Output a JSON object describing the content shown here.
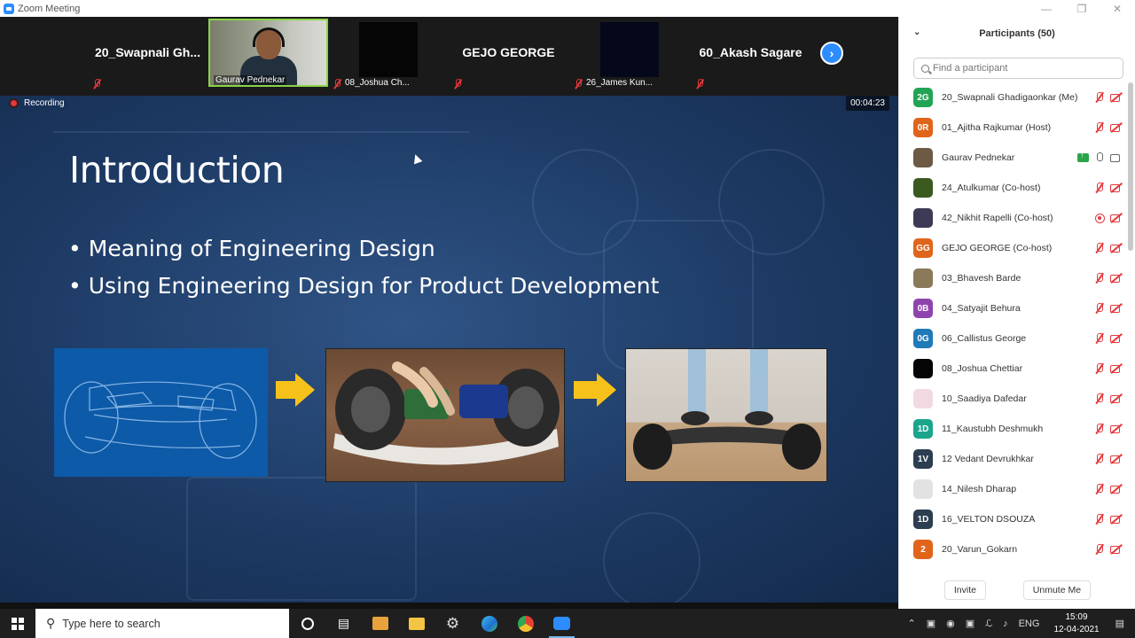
{
  "window": {
    "title": "Zoom Meeting"
  },
  "gallery": {
    "tiles": [
      {
        "name": "20_Swapnali  Gh...",
        "label": ""
      },
      {
        "name": "",
        "label": "Gaurav Pednekar"
      },
      {
        "name": "",
        "label": "08_Joshua Ch..."
      },
      {
        "name": "GEJO GEORGE",
        "label": ""
      },
      {
        "name": "",
        "label": "26_James Kun..."
      },
      {
        "name": "60_Akash Sagare",
        "label": ""
      }
    ]
  },
  "recording": {
    "label": "Recording",
    "timer": "00:04:23"
  },
  "slide": {
    "title": "Introduction",
    "bullets": [
      "Meaning of Engineering Design",
      "Using Engineering Design for Product Development"
    ]
  },
  "panel": {
    "title": "Participants (50)",
    "search_placeholder": "Find a participant",
    "participants": [
      {
        "initials": "2G",
        "name": "20_Swapnali Ghadigaonkar (Me)",
        "color": "#23a455"
      },
      {
        "initials": "0R",
        "name": "01_Ajitha Rajkumar (Host)",
        "color": "#e0651b"
      },
      {
        "initials": "",
        "name": "Gaurav Pednekar",
        "color": "#6d5a45"
      },
      {
        "initials": "",
        "name": "24_Atulkumar (Co-host)",
        "color": "#3a5a1f"
      },
      {
        "initials": "",
        "name": "42_Nikhit Rapelli (Co-host)",
        "color": "#3d3a55"
      },
      {
        "initials": "GG",
        "name": "GEJO GEORGE (Co-host)",
        "color": "#e0651b"
      },
      {
        "initials": "",
        "name": "03_Bhavesh Barde",
        "color": "#8a7a5a"
      },
      {
        "initials": "0B",
        "name": "04_Satyajit Behura",
        "color": "#8e44ad"
      },
      {
        "initials": "0G",
        "name": "06_Callistus George",
        "color": "#1f7ab8"
      },
      {
        "initials": "",
        "name": "08_Joshua Chettiar",
        "color": "#050505"
      },
      {
        "initials": "",
        "name": "10_Saadiya Dafedar",
        "color": "#f1d9e2"
      },
      {
        "initials": "1D",
        "name": "11_Kaustubh Deshmukh",
        "color": "#1aa58c"
      },
      {
        "initials": "1V",
        "name": "12 Vedant Devrukhkar",
        "color": "#2c3e50"
      },
      {
        "initials": "",
        "name": "14_Nilesh Dharap",
        "color": "#e2e2e2"
      },
      {
        "initials": "1D",
        "name": "16_VELTON DSOUZA",
        "color": "#2c3e50"
      },
      {
        "initials": "2",
        "name": "20_Varun_Gokarn",
        "color": "#e0651b"
      }
    ],
    "invite_label": "Invite",
    "unmute_label": "Unmute Me"
  },
  "taskbar": {
    "search_placeholder": "Type here to search",
    "language": "ENG",
    "time": "15:09",
    "date": "12-04-2021"
  }
}
